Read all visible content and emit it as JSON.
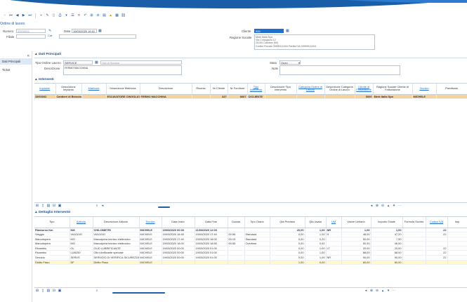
{
  "window": {
    "title": "Ordine di lavoro"
  },
  "toolbar": {
    "icons": [
      "new-icon",
      "first-icon",
      "prev-icon",
      "next-icon",
      "last-icon",
      "save-icon",
      "edit-icon",
      "delete-icon",
      "print-icon",
      "print-dropdown-icon",
      "list-icon",
      "delete-red-icon",
      "undo-icon",
      "hierarchy-icon",
      "attach-icon",
      "document-icon",
      "warning-icon",
      "calendar-icon",
      "link-icon"
    ]
  },
  "header": {
    "numero_label": "Numero",
    "numero_value": "20/00002",
    "data_label": "Data",
    "data_value": "19/03/2020 16:01",
    "filiale_label": "Filiale",
    "cliente_label": "Cliente",
    "cliente_value": "000",
    "ragione_label": "Ragione Sociale",
    "ragione_lines": [
      "Merk Italia Spa",
      "Via Corrugazio 12",
      "20100 Carcano (MI)",
      "Codice Fiscale 09999111204 Partita IVA 09999111204"
    ]
  },
  "sidebar": {
    "items": [
      {
        "label": "Dati Principali"
      },
      {
        "label": "Ticket"
      }
    ]
  },
  "dati_principali": {
    "section_title": "Dati Principali",
    "tipo_label": "Tipo Ordine Lavoro",
    "tipo_code": "SERVICE",
    "tipo_desc": "OdI di Service",
    "descrizione_label": "Descrizione",
    "descrizione_value": "FERMO MACCHINA",
    "stato_label": "Stato",
    "stato_value": "Open",
    "note_label": "Note"
  },
  "interventi": {
    "section_title": "Interventi",
    "columns": [
      {
        "label": "Impianto",
        "link": true
      },
      {
        "label": "Descrizione Impianto",
        "link": false
      },
      {
        "label": "Matricola",
        "link": true
      },
      {
        "label": "Descrizione Matricola",
        "link": false
      },
      {
        "label": "Descrizione",
        "link": false
      },
      {
        "label": "Risorsa",
        "link": false
      },
      {
        "label": "Nr Cliente",
        "link": false
      },
      {
        "label": "Nr Fornitore",
        "link": false
      },
      {
        "label": "Tipo Intervento",
        "link": true
      },
      {
        "label": "Descrizione Tipo Intervento",
        "link": false
      },
      {
        "label": "Categoria Ordine di Lavoro",
        "link": true
      },
      {
        "label": "Descrizione Categoria Ordine di Lavoro",
        "link": false
      },
      {
        "label": "Cliente di Fatturazione",
        "link": true
      },
      {
        "label": "Ragione Sociale Cliente di Fatturazione",
        "link": false
      },
      {
        "label": "Tecnico",
        "link": true
      },
      {
        "label": "Pianificato",
        "link": false
      }
    ],
    "rows": [
      [
        "19/00002",
        "Cantiere di Brescia 2020125",
        "",
        "ESCAVATORE CINGOLATO",
        "FERMO MACCHINA",
        "",
        "347",
        "6667",
        "C/CLIENTE",
        "",
        "",
        "",
        "0000",
        "Merk Italia Spa",
        "MICHELE",
        ""
      ]
    ]
  },
  "dettaglio": {
    "section_title": "Dettaglio Intervento",
    "columns": [
      {
        "label": "Tipo",
        "link": false
      },
      {
        "label": "Articolo",
        "link": true
      },
      {
        "label": "Descrizione Articolo",
        "link": false
      },
      {
        "label": "Tecnico",
        "link": true
      },
      {
        "label": "Data Inizio",
        "link": false
      },
      {
        "label": "Data Fine",
        "link": false
      },
      {
        "label": "Durata",
        "link": false
      },
      {
        "label": "Tipo Orario",
        "link": false
      },
      {
        "label": "Qtà Prevista",
        "link": false
      },
      {
        "label": "Qtà Usata",
        "link": false
      },
      {
        "label": "UM",
        "link": true
      },
      {
        "label": "Valore Unitario",
        "link": false
      },
      {
        "label": "Importo Totale",
        "link": false
      },
      {
        "label": "Formula Sconto",
        "link": false
      },
      {
        "label": "Codice IVA",
        "link": true
      },
      {
        "label": "Imp",
        "link": false
      }
    ],
    "rows": [
      {
        "style": "bold",
        "cells": [
          "Rimborso Km",
          "KM",
          "CHILOMETRI",
          "MICHELE",
          "19/03/2020 00:00",
          "21/03/2020 12:00",
          "",
          "",
          "20,00",
          "1,00",
          "NR",
          "1,00",
          "1,00",
          "",
          "22",
          ""
        ]
      },
      {
        "style": "",
        "cells": [
          "Viaggio",
          "VIAGGIO",
          "VIAGGIO",
          "MICHELE",
          "19/03/2020 16:45",
          "19/03/2020 17:40",
          "00:56",
          "Standard",
          "0,00",
          "1,00",
          "H",
          "48,00",
          "47,20",
          "",
          "22",
          ""
        ]
      },
      {
        "style": "",
        "cells": [
          "Manodopera",
          "MO",
          "Manodpera tecnico elettronico",
          "MICHELE",
          "19/03/2020 17:40",
          "19/03/2020 18:00",
          "00:15",
          "Standard",
          "0,00",
          "0,20",
          "",
          "50,00",
          "7,50",
          "",
          "",
          ""
        ]
      },
      {
        "style": "",
        "cells": [
          "Manodopera",
          "MO",
          "Manodpera tecnico elettronico",
          "MICHELE",
          "19/03/2020 18:00",
          "19/03/2020 18:55",
          "00:55",
          "Overtime",
          "0,00",
          "0,92",
          "",
          "50,00",
          "46,00",
          "",
          "",
          ""
        ]
      },
      {
        "style": "",
        "cells": [
          "Ricambio",
          "OL",
          "OLIO LUBRIFICANTE",
          "MICHELE",
          "19/03/2020 00:00",
          "19/03/2020 01:00",
          "",
          "",
          "0,00",
          "1,00",
          "LT",
          "20,00",
          "20,00",
          "",
          "22",
          ""
        ]
      },
      {
        "style": "",
        "cells": [
          "Ricambio",
          "LUB250",
          "Olio lubrificante speciale",
          "MICHELE",
          "19/03/2020 00:00",
          "19/03/2020 01:00",
          "",
          "",
          "0,00",
          "1,00",
          "",
          "68,00",
          "68,00",
          "",
          "22",
          ""
        ]
      },
      {
        "style": "",
        "cells": [
          "Servizio",
          "SERVS",
          "SERVIZIO DI VERIFICA SICUREZZA",
          "MICHELE",
          "19/03/2020 00:00",
          "19/03/2020 01:00",
          "",
          "",
          "0,00",
          "1,00",
          "NR",
          "90,00",
          "90,00",
          "",
          "22",
          ""
        ]
      },
      {
        "style": "yel",
        "cells": [
          "Diritto Fisso",
          "DF",
          "Diritto Fisso",
          "MICHELE",
          "",
          "",
          "",
          "",
          "1,00",
          "0,00",
          "",
          "60,00",
          "60,00",
          "",
          "",
          ""
        ]
      }
    ]
  }
}
